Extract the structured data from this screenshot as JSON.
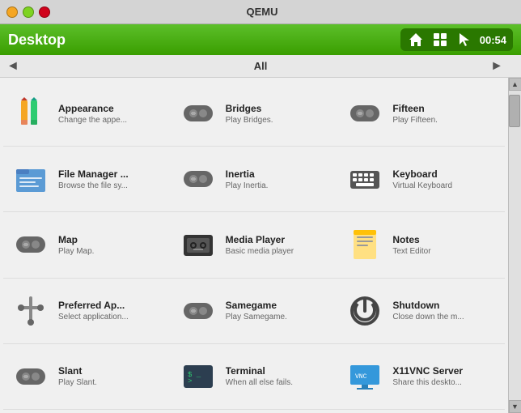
{
  "titlebar": {
    "title": "QEMU",
    "minimize_label": "minimize",
    "maximize_label": "maximize",
    "close_label": "close"
  },
  "header": {
    "desktop_label": "Desktop",
    "time": "00:54"
  },
  "nav": {
    "left_arrow": "◄",
    "right_arrow": "►",
    "section_label": "All"
  },
  "apps": [
    {
      "name": "Appearance",
      "desc": "Change the appe...",
      "icon_type": "appearance"
    },
    {
      "name": "Bridges",
      "desc": "Play Bridges.",
      "icon_type": "gamepad"
    },
    {
      "name": "Fifteen",
      "desc": "Play Fifteen.",
      "icon_type": "gamepad"
    },
    {
      "name": "File Manager ...",
      "desc": "Browse the file sy...",
      "icon_type": "filemanager"
    },
    {
      "name": "Inertia",
      "desc": "Play Inertia.",
      "icon_type": "gamepad"
    },
    {
      "name": "Keyboard",
      "desc": "Virtual Keyboard",
      "icon_type": "keyboard"
    },
    {
      "name": "Map",
      "desc": "Play Map.",
      "icon_type": "gamepad"
    },
    {
      "name": "Media Player",
      "desc": "Basic media player",
      "icon_type": "mediaplayer"
    },
    {
      "name": "Notes",
      "desc": "Text Editor",
      "icon_type": "notes"
    },
    {
      "name": "Preferred Ap...",
      "desc": "Select application...",
      "icon_type": "wrench"
    },
    {
      "name": "Samegame",
      "desc": "Play Samegame.",
      "icon_type": "gamepad"
    },
    {
      "name": "Shutdown",
      "desc": "Close down the m...",
      "icon_type": "shutdown"
    },
    {
      "name": "Slant",
      "desc": "Play Slant.",
      "icon_type": "gamepad"
    },
    {
      "name": "Terminal",
      "desc": "When all else fails.",
      "icon_type": "terminal"
    },
    {
      "name": "X11VNC Server",
      "desc": "Share this deskto...",
      "icon_type": "vnc"
    }
  ]
}
